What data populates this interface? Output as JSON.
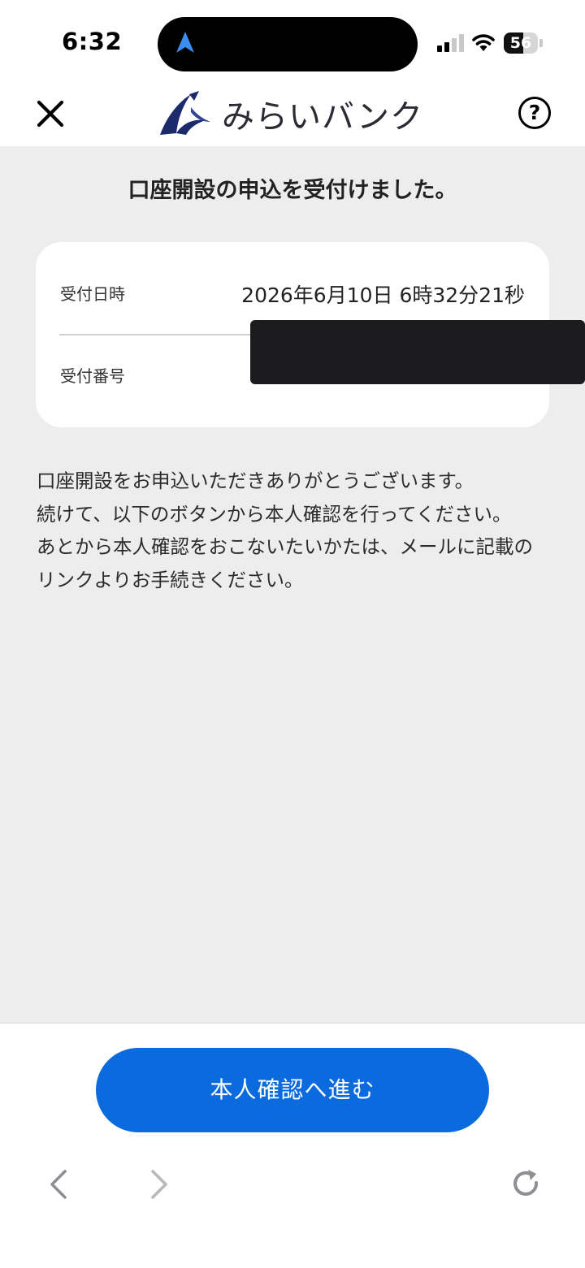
{
  "status_bar": {
    "time": "6:32",
    "battery_level": "56",
    "battery_fraction": 0.56,
    "icons": [
      "location-arrow-icon",
      "signal-icon",
      "wifi-icon",
      "battery-icon"
    ]
  },
  "header": {
    "brand_name": "みらいバンク",
    "close_icon": "close-icon",
    "help_label": "?"
  },
  "main": {
    "title": "口座開設の申込を受付けました。",
    "details": [
      {
        "label": "受付日時",
        "value": "2026年6月10日 6時32分21秒"
      },
      {
        "label": "受付番号",
        "value": ""
      }
    ],
    "message_lines": [
      "口座開設をお申込いただきありがとうございます。",
      "続けて、以下のボタンから本人確認を行ってください。",
      "あとから本人確認をおこないたいかたは、メールに記載のリンクよりお手続きください。"
    ]
  },
  "footer": {
    "cta_label": "本人確認へ進む",
    "browser_icons": [
      "back-icon",
      "forward-icon",
      "reload-icon"
    ]
  },
  "colors": {
    "accent": "#0b6bde",
    "logo_navy": "#1b2a6b",
    "background": "#ededed",
    "card": "#ffffff"
  }
}
